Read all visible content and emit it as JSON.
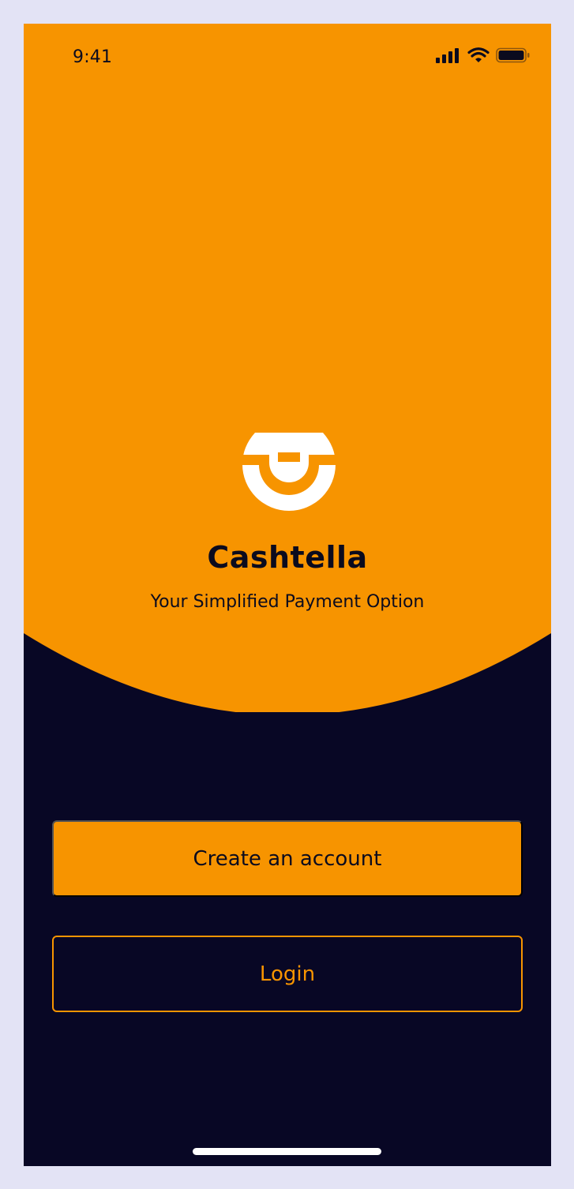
{
  "status_bar": {
    "time": "9:41",
    "icons": [
      "cellular-signal-icon",
      "wifi-icon",
      "battery-icon"
    ]
  },
  "app": {
    "name": "Cashtella",
    "tagline": "Your Simplified Payment Option",
    "logo_icon": "cashtella-logo-icon"
  },
  "actions": {
    "create_account_label": "Create an account",
    "login_label": "Login"
  },
  "colors": {
    "brand_orange": "#f79400",
    "background_navy": "#080725",
    "text_dark": "#0b0b1e",
    "frame_background": "#e3e3f5"
  }
}
